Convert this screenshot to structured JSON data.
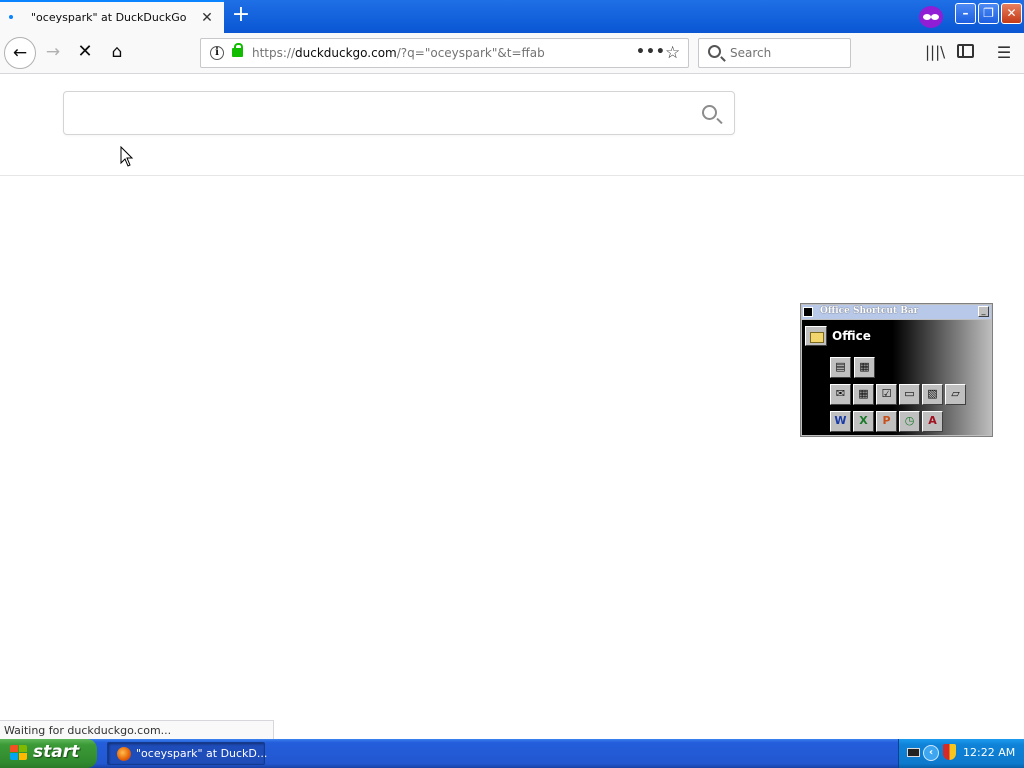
{
  "browser": {
    "tab": {
      "title": "\"oceyspark\" at DuckDuckGo",
      "close_glyph": "✕"
    },
    "new_tab_glyph": "+",
    "window_buttons": {
      "minimize": "–",
      "maximize": "❐",
      "close": "✕"
    },
    "nav": {
      "back_glyph": "←",
      "forward_glyph": "→",
      "stop_glyph": "✕",
      "home_glyph": "⌂"
    },
    "urlbar": {
      "info_glyph": "i",
      "url_prefix": "https://",
      "url_host": "duckduckgo.com",
      "url_rest": "/?q=\"oceyspark\"&t=ffab",
      "more_glyph": "•••",
      "star_glyph": "☆"
    },
    "searchbar": {
      "placeholder": "Search"
    },
    "toolbar": {
      "library_glyph": "|||\\",
      "menu_glyph": "☰"
    },
    "status_text": "Waiting for duckduckgo.com..."
  },
  "page": {
    "search_input": {
      "value": "",
      "placeholder": ""
    }
  },
  "office_bar": {
    "title": "Office Shortcut Bar",
    "minimize_glyph": "_",
    "folder_label": "Office",
    "apps": {
      "word": "W",
      "excel": "X",
      "powerpoint": "P",
      "access": "A"
    },
    "glyphs": {
      "new_doc": "▤",
      "open_doc": "▦",
      "mail": "✉",
      "calendar": "▦",
      "task": "☑",
      "contact": "▭",
      "journal": "▧",
      "note": "▱",
      "schedule": "◷"
    }
  },
  "taskbar": {
    "start_label": "start",
    "task_label": "\"oceyspark\" at DuckD...",
    "clock": "12:22 AM",
    "chevron_glyph": "‹"
  }
}
